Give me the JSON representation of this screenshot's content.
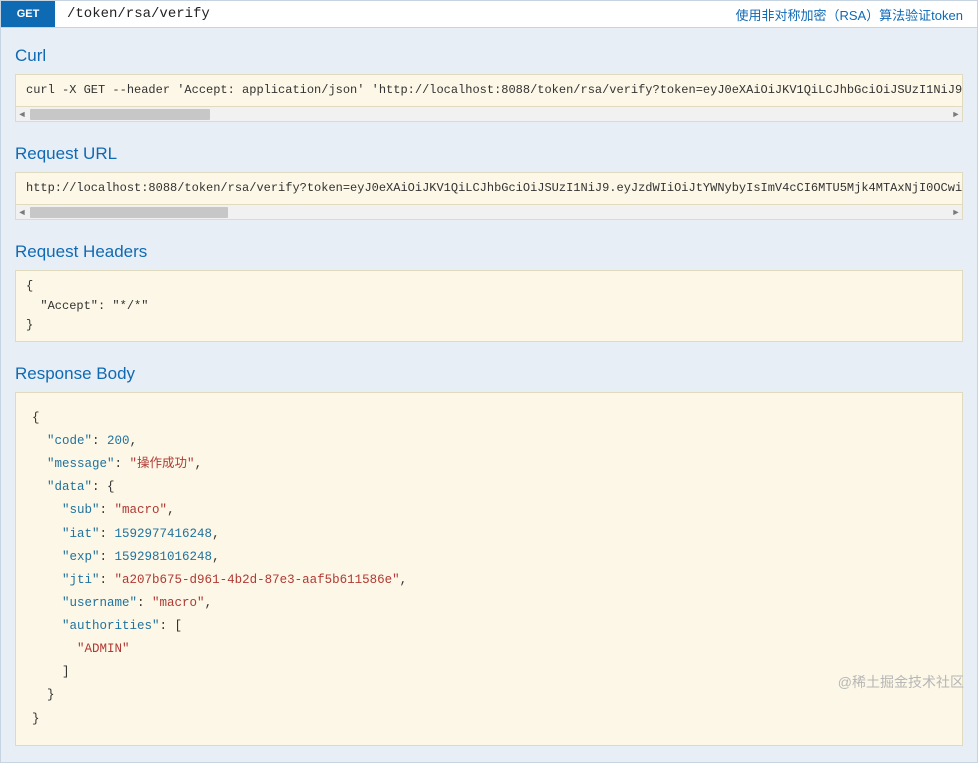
{
  "header": {
    "method": "GET",
    "path": "/token/rsa/verify",
    "summary": "使用非对称加密（RSA）算法验证token"
  },
  "sections": {
    "curl": {
      "title": "Curl",
      "content": "curl -X GET --header 'Accept: application/json' 'http://localhost:8088/token/rsa/verify?token=eyJ0eXAiOiJKV1QiLCJhbGciOiJSUzI1NiJ9"
    },
    "request_url": {
      "title": "Request URL",
      "content": "http://localhost:8088/token/rsa/verify?token=eyJ0eXAiOiJKV1QiLCJhbGciOiJSUzI1NiJ9.eyJzdWIiOiJtYWNybyIsImV4cCI6MTU5Mjk4MTAxNjI0OCwi"
    },
    "request_headers": {
      "title": "Request Headers",
      "content": "{\n  \"Accept\": \"*/*\"\n}"
    },
    "response_body": {
      "title": "Response Body",
      "data": {
        "code": 200,
        "message": "操作成功",
        "sub": "macro",
        "iat": 1592977416248,
        "exp": 1592981016248,
        "jti": "a207b675-d961-4b2d-87e3-aaf5b611586e",
        "username": "macro",
        "authority": "ADMIN"
      }
    }
  },
  "scrollbar": {
    "thumb_width_curl": "180px",
    "thumb_width_url": "198px"
  },
  "watermark": "@稀土掘金技术社区"
}
